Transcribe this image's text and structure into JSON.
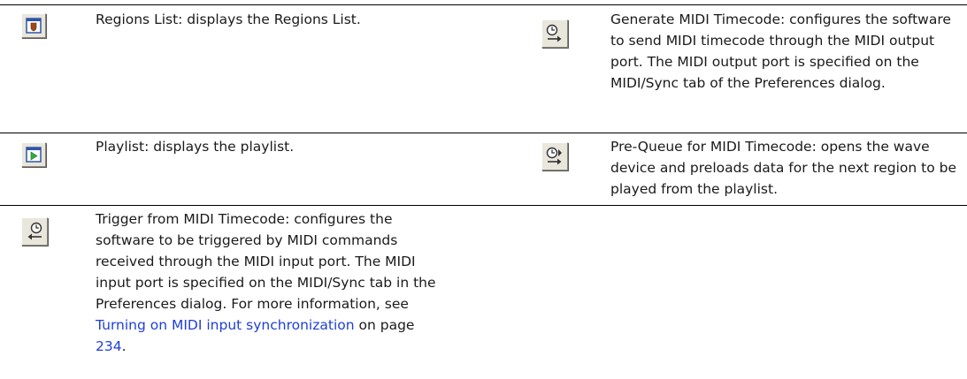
{
  "rows": [
    {
      "left": {
        "icon": "regions-list-icon",
        "text": "Regions List: displays the Regions List."
      },
      "right": {
        "icon": "generate-midi-timecode-icon",
        "text": "Generate MIDI Timecode: configures the software to send MIDI timecode through the MIDI output port. The MIDI output port is specified on the MIDI/Sync tab of the Preferences dialog."
      }
    },
    {
      "left": {
        "icon": "playlist-icon",
        "text": "Playlist: displays the playlist."
      },
      "right": {
        "icon": "pre-queue-midi-timecode-icon",
        "text": "Pre-Queue for MIDI Timecode: opens the wave device and preloads data for the next region to be played from the playlist."
      }
    },
    {
      "left": {
        "icon": "trigger-midi-timecode-icon",
        "text_before": "Trigger from MIDI Timecode: configures the software to be triggered by MIDI commands received through the MIDI input port. The MIDI input port is specified on the MIDI/Sync tab in the Preferences dialog. For more information, see",
        "link_text": "Turning on MIDI input synchronization",
        "text_middle": "on page",
        "page_link": "234",
        "text_after": "."
      }
    }
  ]
}
